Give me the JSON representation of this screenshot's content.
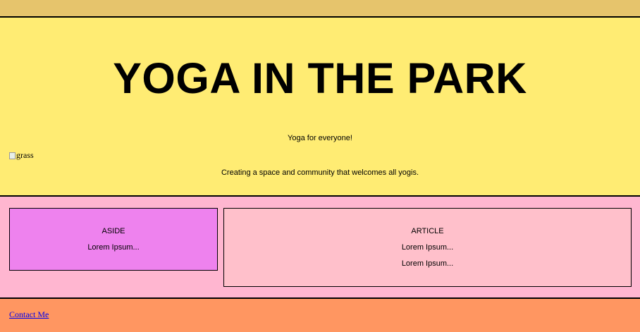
{
  "header": {
    "title": "YOGA IN THE PARK",
    "tagline": "Yoga for everyone!",
    "image_alt": "grass",
    "mission": "Creating a space and community that welcomes all yogis."
  },
  "aside": {
    "heading": "ASIDE",
    "text": "Lorem Ipsum..."
  },
  "article": {
    "heading": "ARTICLE",
    "lines": [
      "Lorem Ipsum...",
      "Lorem Ipsum..."
    ]
  },
  "footer": {
    "contact_link": "Contact Me"
  },
  "colors": {
    "topbar": "#e6c46c",
    "header": "#ffec73",
    "main": "#ffb6d0",
    "aside": "#ee82ee",
    "article": "#ffc0cb",
    "footer": "#ff9661",
    "link": "#0000ee"
  },
  "icons": {
    "image": "broken-image-icon"
  }
}
